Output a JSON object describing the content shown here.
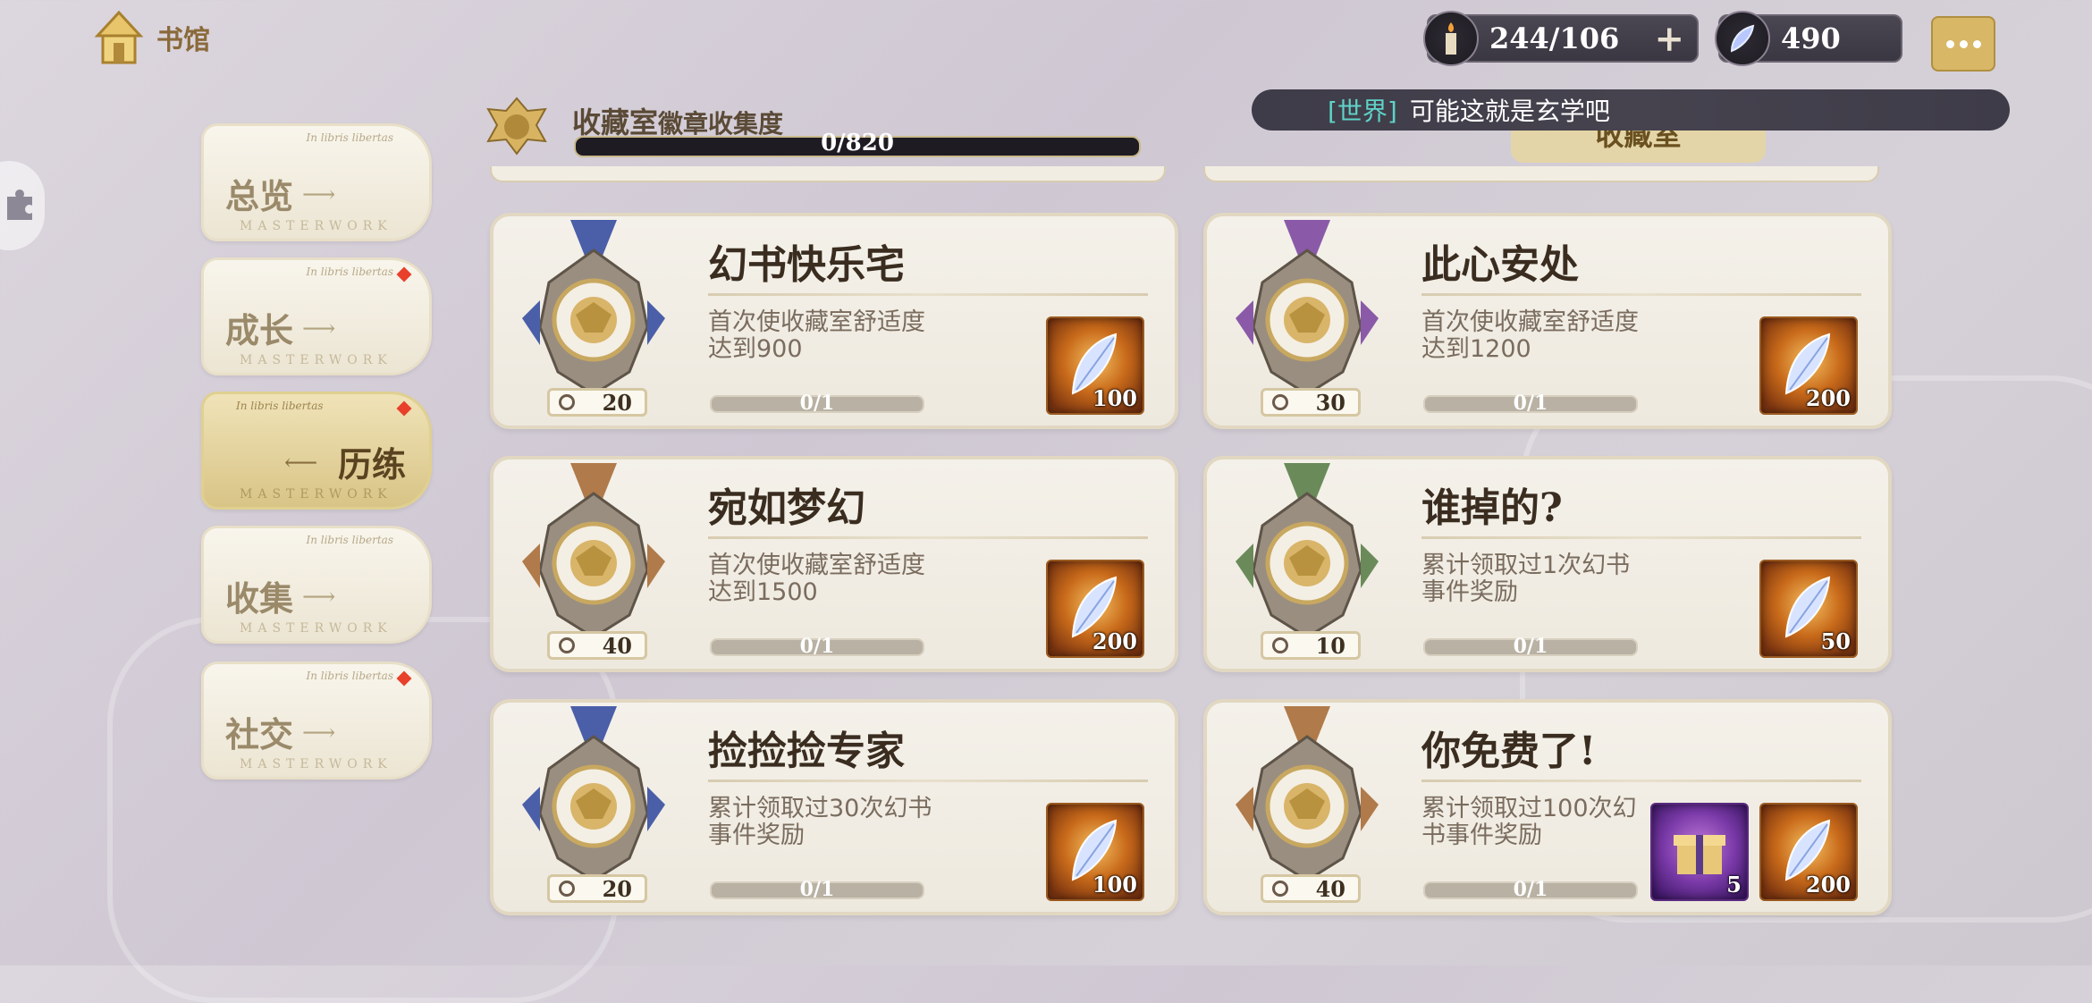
{
  "header": {
    "home_label": "书馆",
    "resource_candle": "244/106",
    "resource_crystal": "490",
    "plus_symbol": "+"
  },
  "world_chat": {
    "tag": "[世界]",
    "message": "可能这就是玄学吧",
    "behind_tab": "收藏室"
  },
  "nav": {
    "latin": "In libris libertas",
    "masterwork": "MASTERWORK",
    "items": [
      {
        "label": "总览",
        "active": false,
        "dot": false
      },
      {
        "label": "成长",
        "active": false,
        "dot": true
      },
      {
        "label": "历练",
        "active": true,
        "dot": true
      },
      {
        "label": "收集",
        "active": false,
        "dot": false
      },
      {
        "label": "社交",
        "active": false,
        "dot": true
      }
    ]
  },
  "collection": {
    "title": "收藏室",
    "subtitle": "徽章收集度",
    "progress": "0/820",
    "progress_fraction": 0
  },
  "cards": [
    {
      "title": "幻书快乐宅",
      "desc": "首次使收藏室舒适度达到900",
      "level": "20",
      "progress": "0/1",
      "ribbon": "#4a5fa8",
      "rewards": [
        {
          "type": "feather",
          "qty": "100"
        }
      ]
    },
    {
      "title": "此心安处",
      "desc": "首次使收藏室舒适度达到1200",
      "level": "30",
      "progress": "0/1",
      "ribbon": "#8a5aa8",
      "rewards": [
        {
          "type": "feather",
          "qty": "200"
        }
      ]
    },
    {
      "title": "宛如梦幻",
      "desc": "首次使收藏室舒适度达到1500",
      "level": "40",
      "progress": "0/1",
      "ribbon": "#b07a4a",
      "rewards": [
        {
          "type": "feather",
          "qty": "200"
        }
      ]
    },
    {
      "title": "谁掉的?",
      "desc": "累计领取过1次幻书事件奖励",
      "level": "10",
      "progress": "0/1",
      "ribbon": "#6a8a5a",
      "rewards": [
        {
          "type": "feather",
          "qty": "50"
        }
      ]
    },
    {
      "title": "捡捡捡专家",
      "desc": "累计领取过30次幻书事件奖励",
      "level": "20",
      "progress": "0/1",
      "ribbon": "#4a5fa8",
      "rewards": [
        {
          "type": "feather",
          "qty": "100"
        }
      ]
    },
    {
      "title": "你免费了!",
      "desc": "累计领取过100次幻书事件奖励",
      "level": "40",
      "progress": "0/1",
      "ribbon": "#b07a4a",
      "rewards": [
        {
          "type": "gift-box",
          "qty": "5"
        },
        {
          "type": "feather",
          "qty": "200"
        }
      ]
    }
  ]
}
